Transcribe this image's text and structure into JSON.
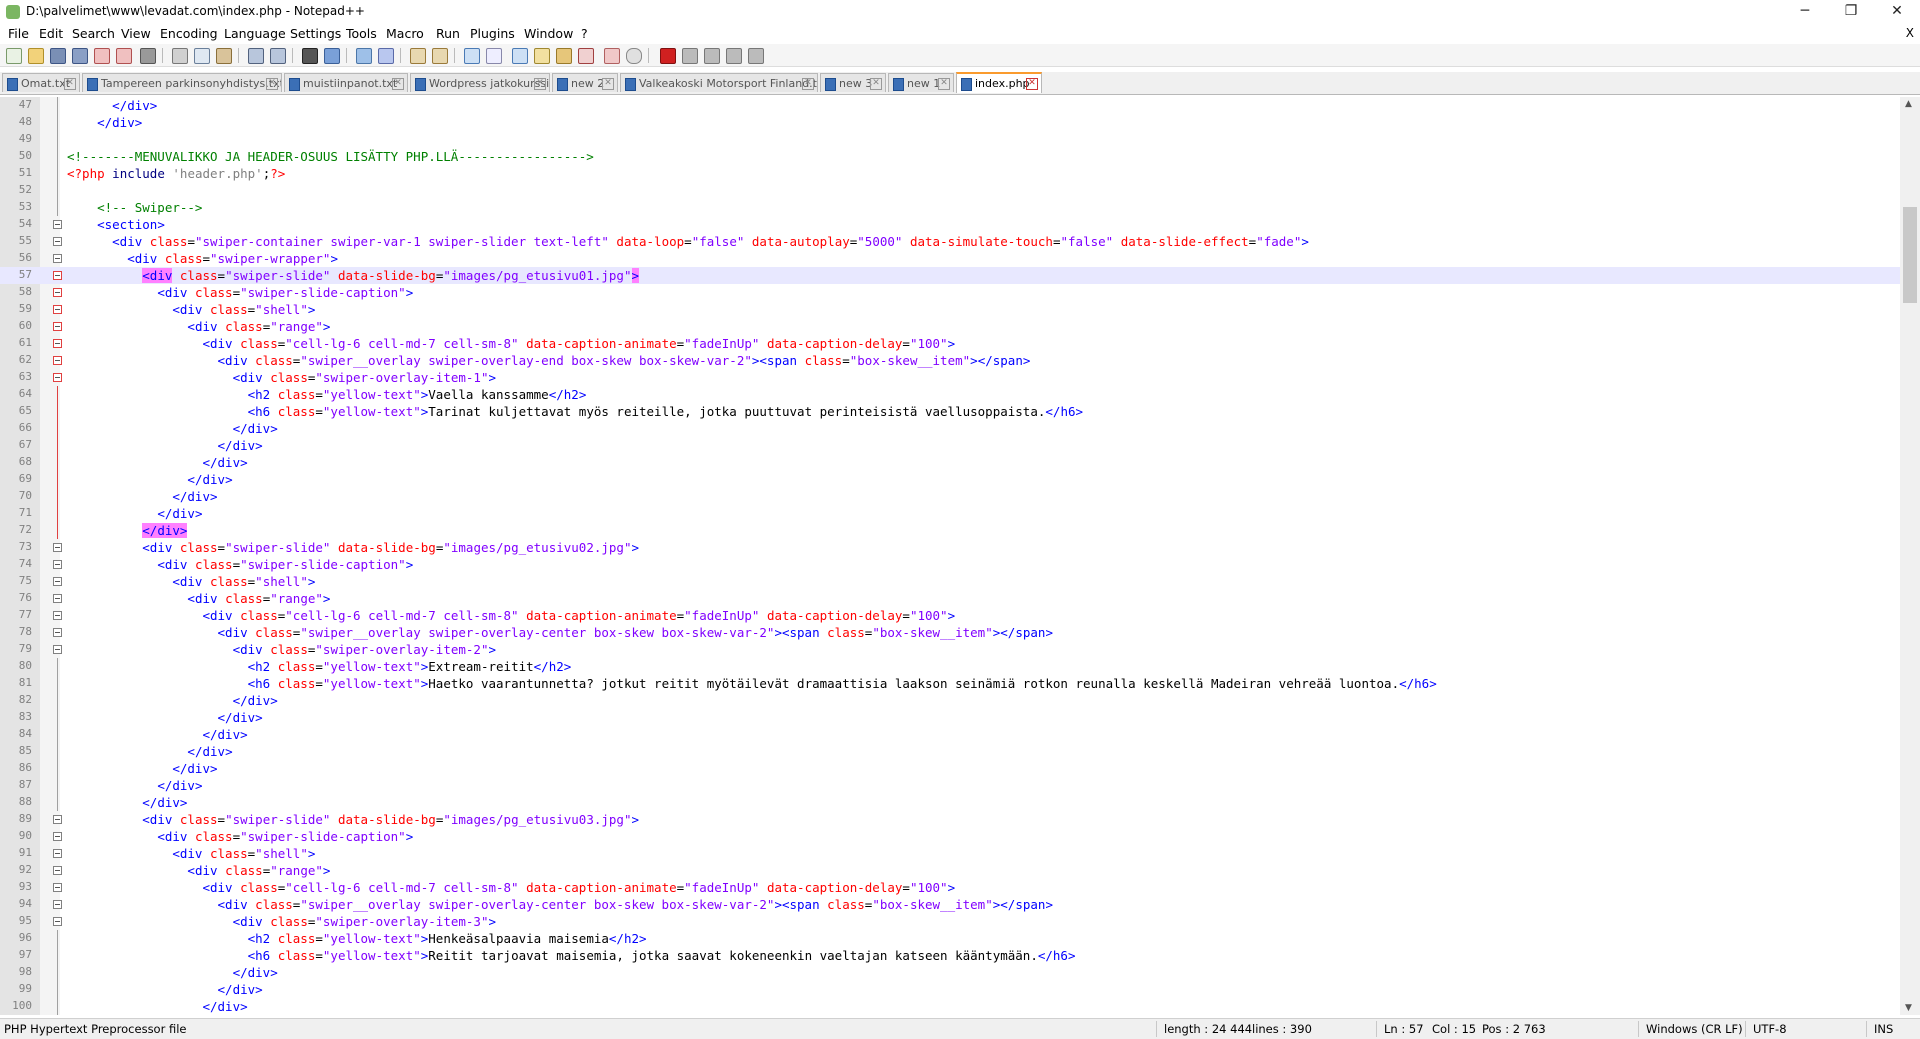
{
  "window": {
    "title": "D:\\palvelimet\\www\\levadat.com\\index.php - Notepad++",
    "minimize": "─",
    "restore": "❐",
    "close": "✕"
  },
  "menu": {
    "items": [
      "File",
      "Edit",
      "Search",
      "View",
      "Encoding",
      "Language",
      "Settings",
      "Tools",
      "Macro",
      "Run",
      "Plugins",
      "Window",
      "?"
    ],
    "close_doc": "X"
  },
  "toolbar": {
    "buttons": [
      "new-file",
      "open-file",
      "save",
      "save-all",
      "close",
      "close-all",
      "print",
      "cut",
      "copy",
      "paste",
      "undo",
      "redo",
      "find",
      "replace",
      "zoom-in",
      "zoom-out",
      "sync-v",
      "sync-h",
      "word-wrap",
      "show-all-chars",
      "indent-guide",
      "udl",
      "doc-map",
      "function-list",
      "folder-workspace",
      "monitor",
      "record-macro",
      "stop-macro",
      "play-macro",
      "run-macro-multiple",
      "save-macro"
    ]
  },
  "tabs": [
    {
      "label": "Omat.txt",
      "active": false
    },
    {
      "label": "Tampereen parkinsonyhdistys.txt",
      "active": false
    },
    {
      "label": "muistiinpanot.txt",
      "active": false
    },
    {
      "label": "Wordpress jatkokurssi.txt",
      "active": false
    },
    {
      "label": "new 2",
      "active": false
    },
    {
      "label": "Valkeakoski Motorsport Finland.txt",
      "active": false
    },
    {
      "label": "new 3",
      "active": false
    },
    {
      "label": "new 1",
      "active": false
    },
    {
      "label": "index.php",
      "active": true
    }
  ],
  "editor": {
    "current_line": 57,
    "lines": [
      {
        "n": "47",
        "code": "      </div>"
      },
      {
        "n": "48",
        "code": "    </div>"
      },
      {
        "n": "49",
        "code": ""
      },
      {
        "n": "50",
        "code": "<!-------MENUVALIKKO JA HEADER-OSUUS LISÄTTY PHP.LLÄ----------------->"
      },
      {
        "n": "51",
        "code": "<?php include 'header.php';?>"
      },
      {
        "n": "52",
        "code": ""
      },
      {
        "n": "53",
        "code": "    <!-- Swiper-->"
      },
      {
        "n": "54",
        "code": "    <section>"
      },
      {
        "n": "55",
        "code": "      <div class=\"swiper-container swiper-var-1 swiper-slider text-left\" data-loop=\"false\" data-autoplay=\"5000\" data-simulate-touch=\"false\" data-slide-effect=\"fade\">"
      },
      {
        "n": "56",
        "code": "        <div class=\"swiper-wrapper\">"
      },
      {
        "n": "57",
        "code": "          <div class=\"swiper-slide\" data-slide-bg=\"images/pg_etusivu01.jpg\">"
      },
      {
        "n": "58",
        "code": "            <div class=\"swiper-slide-caption\">"
      },
      {
        "n": "59",
        "code": "              <div class=\"shell\">"
      },
      {
        "n": "60",
        "code": "                <div class=\"range\">"
      },
      {
        "n": "61",
        "code": "                  <div class=\"cell-lg-6 cell-md-7 cell-sm-8\" data-caption-animate=\"fadeInUp\" data-caption-delay=\"100\">"
      },
      {
        "n": "62",
        "code": "                    <div class=\"swiper__overlay swiper-overlay-end box-skew box-skew-var-2\"><span class=\"box-skew__item\"></span>"
      },
      {
        "n": "63",
        "code": "                      <div class=\"swiper-overlay-item-1\">"
      },
      {
        "n": "64",
        "code": "                        <h2 class=\"yellow-text\">Vaella kanssamme</h2>"
      },
      {
        "n": "65",
        "code": "                        <h6 class=\"yellow-text\">Tarinat kuljettavat myös reiteille, jotka puuttuvat perinteisistä vaellusoppaista.</h6>"
      },
      {
        "n": "66",
        "code": "                      </div>"
      },
      {
        "n": "67",
        "code": "                    </div>"
      },
      {
        "n": "68",
        "code": "                  </div>"
      },
      {
        "n": "69",
        "code": "                </div>"
      },
      {
        "n": "70",
        "code": "              </div>"
      },
      {
        "n": "71",
        "code": "            </div>"
      },
      {
        "n": "72",
        "code": "          </div>"
      },
      {
        "n": "73",
        "code": "          <div class=\"swiper-slide\" data-slide-bg=\"images/pg_etusivu02.jpg\">"
      },
      {
        "n": "74",
        "code": "            <div class=\"swiper-slide-caption\">"
      },
      {
        "n": "75",
        "code": "              <div class=\"shell\">"
      },
      {
        "n": "76",
        "code": "                <div class=\"range\">"
      },
      {
        "n": "77",
        "code": "                  <div class=\"cell-lg-6 cell-md-7 cell-sm-8\" data-caption-animate=\"fadeInUp\" data-caption-delay=\"100\">"
      },
      {
        "n": "78",
        "code": "                    <div class=\"swiper__overlay swiper-overlay-center box-skew box-skew-var-2\"><span class=\"box-skew__item\"></span>"
      },
      {
        "n": "79",
        "code": "                      <div class=\"swiper-overlay-item-2\">"
      },
      {
        "n": "80",
        "code": "                        <h2 class=\"yellow-text\">Extream-reitit</h2>"
      },
      {
        "n": "81",
        "code": "                        <h6 class=\"yellow-text\">Haetko vaarantunnetta? jotkut reitit myötäilevät dramaattisia laakson seinämiä rotkon reunalla keskellä Madeiran vehreää luontoa.</h6>"
      },
      {
        "n": "82",
        "code": "                      </div>"
      },
      {
        "n": "83",
        "code": "                    </div>"
      },
      {
        "n": "84",
        "code": "                  </div>"
      },
      {
        "n": "85",
        "code": "                </div>"
      },
      {
        "n": "86",
        "code": "              </div>"
      },
      {
        "n": "87",
        "code": "            </div>"
      },
      {
        "n": "88",
        "code": "          </div>"
      },
      {
        "n": "89",
        "code": "          <div class=\"swiper-slide\" data-slide-bg=\"images/pg_etusivu03.jpg\">"
      },
      {
        "n": "90",
        "code": "            <div class=\"swiper-slide-caption\">"
      },
      {
        "n": "91",
        "code": "              <div class=\"shell\">"
      },
      {
        "n": "92",
        "code": "                <div class=\"range\">"
      },
      {
        "n": "93",
        "code": "                  <div class=\"cell-lg-6 cell-md-7 cell-sm-8\" data-caption-animate=\"fadeInUp\" data-caption-delay=\"100\">"
      },
      {
        "n": "94",
        "code": "                    <div class=\"swiper__overlay swiper-overlay-center box-skew box-skew-var-2\"><span class=\"box-skew__item\"></span>"
      },
      {
        "n": "95",
        "code": "                      <div class=\"swiper-overlay-item-3\">"
      },
      {
        "n": "96",
        "code": "                        <h2 class=\"yellow-text\">Henkeäsalpaavia maisemia</h2>"
      },
      {
        "n": "97",
        "code": "                        <h6 class=\"yellow-text\">Reitit tarjoavat maisemia, jotka saavat kokeneenkin vaeltajan katseen kääntymään.</h6>"
      },
      {
        "n": "98",
        "code": "                      </div>"
      },
      {
        "n": "99",
        "code": "                    </div>"
      },
      {
        "n": "100",
        "code": "                  </div>"
      }
    ]
  },
  "status": {
    "file_type": "PHP Hypertext Preprocessor file",
    "length": "length : 24 444",
    "lines": "lines : 390",
    "ln": "Ln : 57",
    "col": "Col : 15",
    "pos": "Pos : 2 763",
    "eol": "Windows (CR LF)",
    "encoding": "UTF-8",
    "mode": "INS"
  },
  "colors": {
    "tag": "#0000ff",
    "attr": "#ff0000",
    "value": "#8000ff",
    "comment": "#008000",
    "php": "#ff0000",
    "current_line": "#e8e8ff",
    "tab_accent": "#fa9b2e"
  }
}
